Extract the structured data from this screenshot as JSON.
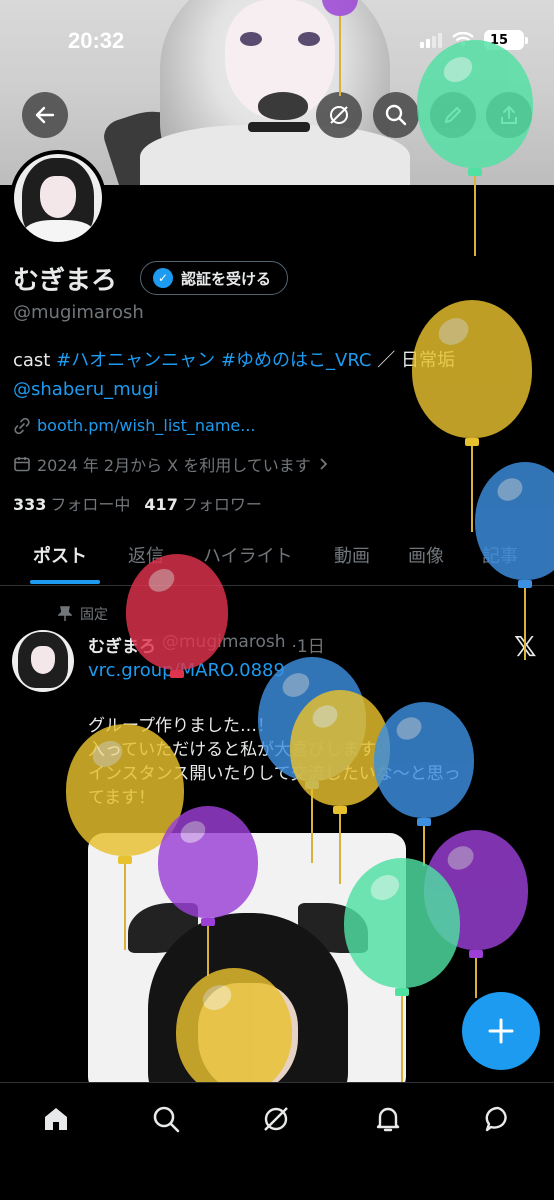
{
  "status_bar": {
    "time": "20:32",
    "battery": "15"
  },
  "profile": {
    "name": "むぎまろ",
    "verify_button": "認証を受ける",
    "handle": "@mugimarosh",
    "bio_prefix": "cast ",
    "bio_tag1": "#ハオニャンニャン",
    "bio_space": " ",
    "bio_tag2": "#ゆめのはこ_VRC",
    "bio_suffix": " ／ 日常垢",
    "bio_mention": "@shaberu_mugi",
    "url": "booth.pm/wish_list_name...",
    "joined": "2024 年 2月から X を利用しています",
    "following_count": "333",
    "following_label": "フォロー中",
    "followers_count": "417",
    "followers_label": "フォロワー"
  },
  "tabs": [
    "ポスト",
    "返信",
    "ハイライト",
    "動画",
    "画像",
    "記事"
  ],
  "post": {
    "pinned_label": "固定",
    "author_name": "むぎまろ",
    "author_handle": "@mugimarosh",
    "time": "·1日",
    "link": "vrc.group/MARO.0889",
    "text_lines": [
      "グループ作りました…！",
      "入っていただけると私が大喜びします♡",
      "インスタンス開いたりして交流したいな〜と思っ",
      "てます！"
    ]
  },
  "colors": {
    "accent": "#1d9bf0",
    "background": "#000000",
    "muted": "#71767b"
  },
  "icons": [
    "back-arrow-icon",
    "grok-icon",
    "search-icon",
    "edit-icon",
    "share-icon",
    "link-icon",
    "calendar-icon",
    "pin-icon",
    "x-logo-icon",
    "plus-icon",
    "home-icon",
    "explore-icon",
    "grok-nav-icon",
    "bell-icon",
    "messages-icon"
  ]
}
